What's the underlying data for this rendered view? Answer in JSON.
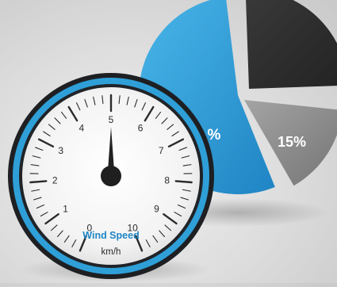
{
  "pie": {
    "slices": [
      {
        "name": "blue-slice",
        "color": "#2f9fd8",
        "label": "%"
      },
      {
        "name": "gray-slice",
        "color": "#8a8a8a",
        "label": "15%",
        "share_pct": 15
      },
      {
        "name": "dark-slice",
        "color": "#2e2e2e"
      }
    ]
  },
  "gauge": {
    "title": "Wind Speed",
    "unit": "km/h",
    "ticks": [
      "0",
      "1",
      "2",
      "3",
      "4",
      "5",
      "6",
      "7",
      "8",
      "9",
      "10"
    ],
    "min": 0,
    "max": 10,
    "value": 5,
    "accent_color": "#2f9fd8",
    "title_color": "#1f86c6"
  }
}
